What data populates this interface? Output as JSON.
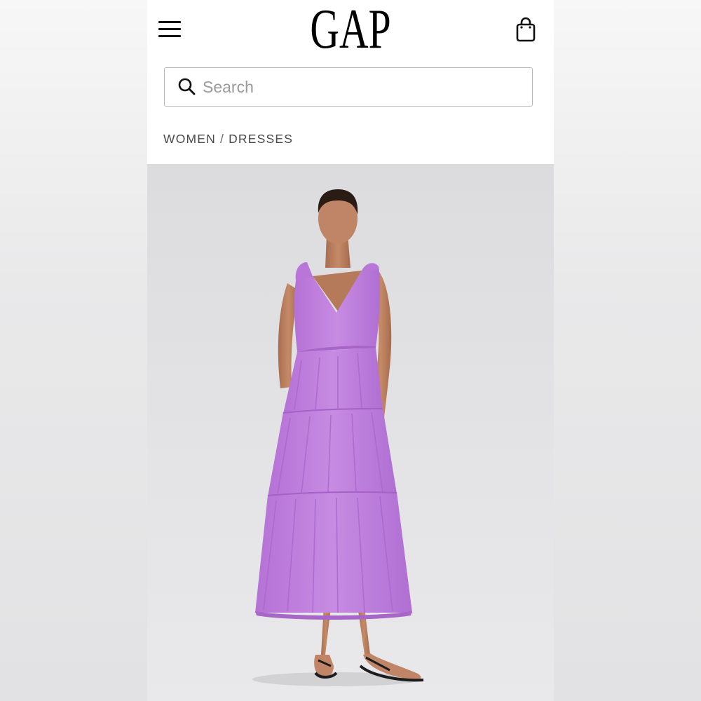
{
  "header": {
    "logo_text": "GAP",
    "menu_icon": "hamburger-menu-icon",
    "bag_icon": "shopping-bag-icon"
  },
  "search": {
    "placeholder": "Search",
    "value": "",
    "icon": "search-icon"
  },
  "breadcrumb": {
    "items": [
      "WOMEN",
      "DRESSES"
    ],
    "separator": "/"
  },
  "product": {
    "image": "model-in-purple-tiered-maxi-dress",
    "dress_color": "#c17fde"
  },
  "colors": {
    "background": "#ffffff",
    "text": "#111111",
    "breadcrumb_text": "#4a4a4a",
    "search_border": "#b8b8b8",
    "image_background": "#e2e2e4"
  }
}
